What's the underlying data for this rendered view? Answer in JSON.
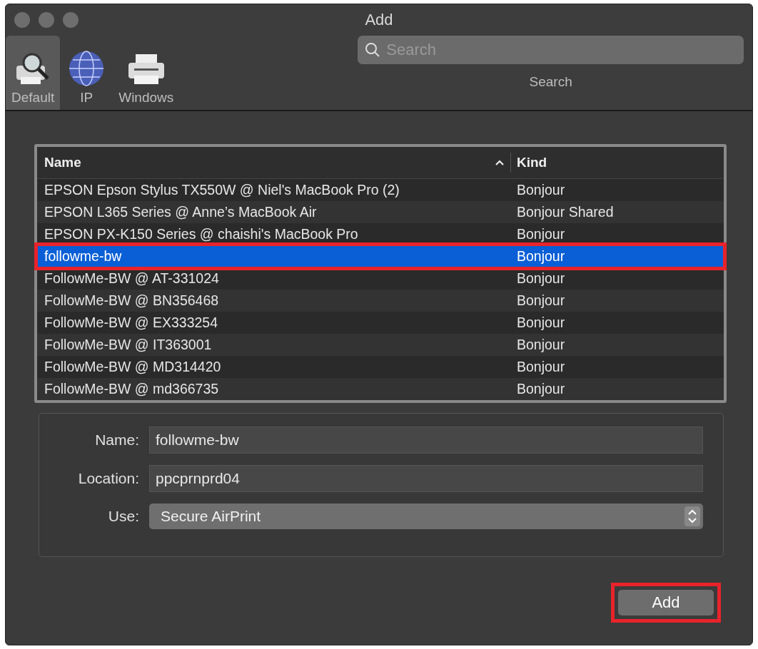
{
  "window": {
    "title": "Add"
  },
  "toolbar": {
    "items": [
      {
        "label": "Default",
        "kind": "default",
        "selected": true
      },
      {
        "label": "IP",
        "kind": "ip",
        "selected": false
      },
      {
        "label": "Windows",
        "kind": "windows",
        "selected": false
      }
    ],
    "search": {
      "placeholder": "Search",
      "label": "Search"
    }
  },
  "table": {
    "columns": [
      {
        "label": "Name",
        "sorted_ascending": true
      },
      {
        "label": "Kind"
      }
    ],
    "rows": [
      {
        "name": "EPSON Epson Stylus TX550W @ Niel's MacBook Pro (2)",
        "kind": "Bonjour",
        "selected": false,
        "highlighted": false
      },
      {
        "name": "EPSON L365 Series @ Anne’s MacBook Air",
        "kind": "Bonjour Shared",
        "selected": false,
        "highlighted": false
      },
      {
        "name": "EPSON PX-K150 Series @ chaishi's MacBook Pro",
        "kind": "Bonjour",
        "selected": false,
        "highlighted": false
      },
      {
        "name": "followme-bw",
        "kind": "Bonjour",
        "selected": true,
        "highlighted": true
      },
      {
        "name": "FollowMe-BW @ AT-331024",
        "kind": "Bonjour",
        "selected": false,
        "highlighted": false
      },
      {
        "name": "FollowMe-BW @ BN356468",
        "kind": "Bonjour",
        "selected": false,
        "highlighted": false
      },
      {
        "name": "FollowMe-BW @ EX333254",
        "kind": "Bonjour",
        "selected": false,
        "highlighted": false
      },
      {
        "name": "FollowMe-BW @ IT363001",
        "kind": "Bonjour",
        "selected": false,
        "highlighted": false
      },
      {
        "name": "FollowMe-BW @ MD314420",
        "kind": "Bonjour",
        "selected": false,
        "highlighted": false
      },
      {
        "name": "FollowMe-BW @ md366735",
        "kind": "Bonjour",
        "selected": false,
        "highlighted": false
      }
    ]
  },
  "details": {
    "fields": [
      {
        "label": "Name:",
        "value": "followme-bw",
        "kind": "text"
      },
      {
        "label": "Location:",
        "value": "ppcprnprd04",
        "kind": "text"
      },
      {
        "label": "Use:",
        "value": "Secure AirPrint",
        "kind": "popup"
      }
    ]
  },
  "add_button": {
    "label": "Add",
    "highlighted": true
  }
}
